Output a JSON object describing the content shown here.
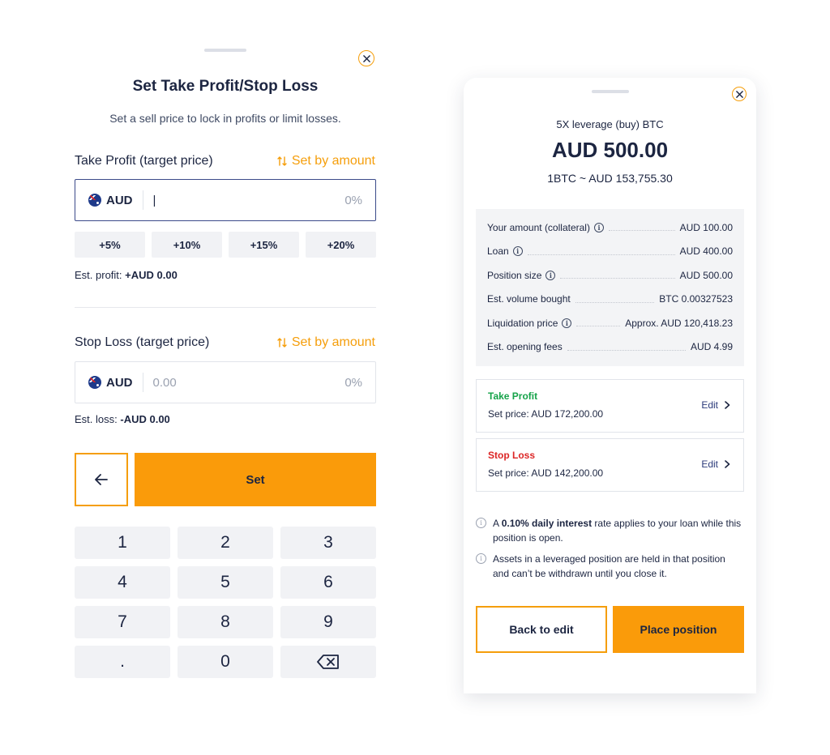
{
  "colors": {
    "accent": "#fa9b0a",
    "accent_border": "#f59e0b",
    "text": "#1c2541",
    "take_profit": "#16a34a",
    "stop_loss": "#dc2626"
  },
  "left": {
    "title": "Set Take Profit/Stop Loss",
    "subtitle": "Set a sell price to lock in profits or limit losses.",
    "set_by_amount": "Set by amount",
    "take_profit": {
      "label": "Take Profit (target price)",
      "currency": "AUD",
      "value": "|",
      "percent": "0%",
      "chips": [
        "+5%",
        "+10%",
        "+15%",
        "+20%"
      ],
      "est_label": "Est. profit:",
      "est_value": "+AUD 0.00"
    },
    "stop_loss": {
      "label": "Stop Loss (target price)",
      "currency": "AUD",
      "placeholder": "0.00",
      "percent": "0%",
      "est_label": "Est. loss:",
      "est_value": "-AUD 0.00"
    },
    "set_button": "Set",
    "keypad": [
      "1",
      "2",
      "3",
      "4",
      "5",
      "6",
      "7",
      "8",
      "9",
      ".",
      "0"
    ]
  },
  "right": {
    "subtitle": "5X leverage (buy) BTC",
    "amount": "AUD 500.00",
    "rate": "1BTC ~  AUD 153,755.30",
    "summary": [
      {
        "label": "Your amount (collateral)",
        "info": true,
        "value": "AUD 100.00"
      },
      {
        "label": "Loan",
        "info": true,
        "value": "AUD 400.00"
      },
      {
        "label": "Position size",
        "info": true,
        "value": "AUD 500.00"
      },
      {
        "label": "Est. volume bought",
        "info": false,
        "value": "BTC 0.00327523"
      },
      {
        "label": "Liquidation price",
        "info": true,
        "value": "Approx. AUD 120,418.23"
      },
      {
        "label": "Est. opening fees",
        "info": false,
        "value": "AUD 4.99"
      }
    ],
    "take_profit_card": {
      "title": "Take Profit",
      "price": "Set price:  AUD 172,200.00",
      "edit": "Edit"
    },
    "stop_loss_card": {
      "title": "Stop Loss",
      "price": "Set price:  AUD 142,200.00",
      "edit": "Edit"
    },
    "note1": {
      "prefix": "A ",
      "bold": "0.10% daily interest",
      "suffix": " rate applies to your loan while this position is open."
    },
    "note2": "Assets in a leveraged position are held in that position and can’t be withdrawn until you close it.",
    "back_button": "Back to edit",
    "place_button": "Place position"
  }
}
